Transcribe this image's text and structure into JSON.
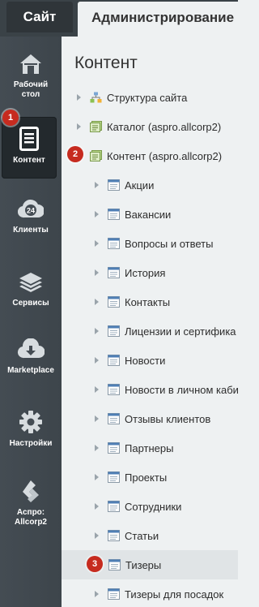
{
  "tabs": {
    "site": "Сайт",
    "admin": "Администрирование"
  },
  "sidebar": {
    "items": [
      {
        "label_lines": [
          "Рабочий",
          "стол"
        ],
        "icon": "home-icon"
      },
      {
        "label_lines": [
          "Контент"
        ],
        "icon": "document-icon"
      },
      {
        "label_lines": [
          "Клиенты"
        ],
        "icon": "clients-24-icon"
      },
      {
        "label_lines": [
          "Сервисы"
        ],
        "icon": "layers-icon"
      },
      {
        "label_lines": [
          "Marketplace"
        ],
        "icon": "cloud-download-icon"
      },
      {
        "label_lines": [
          "Настройки"
        ],
        "icon": "gear-icon"
      },
      {
        "label_lines": [
          "Аспро:",
          "Allcorp2"
        ],
        "icon": "aspro-logo-icon"
      }
    ]
  },
  "content": {
    "title": "Контент",
    "tree": [
      {
        "label": "Структура сайта",
        "icon": "site-structure-icon"
      },
      {
        "label": "Каталог (aspro.allcorp2)",
        "icon": "iblock-type-icon"
      },
      {
        "label": "Контент (aspro.allcorp2)",
        "icon": "iblock-type-icon"
      },
      {
        "label": "Акции",
        "icon": "list-icon"
      },
      {
        "label": "Вакансии",
        "icon": "list-icon"
      },
      {
        "label": "Вопросы и ответы",
        "icon": "list-icon"
      },
      {
        "label": "История",
        "icon": "list-icon"
      },
      {
        "label": "Контакты",
        "icon": "list-icon"
      },
      {
        "label": "Лицензии и сертифика",
        "icon": "list-icon"
      },
      {
        "label": "Новости",
        "icon": "list-icon"
      },
      {
        "label": "Новости в личном каби",
        "icon": "list-icon"
      },
      {
        "label": "Отзывы клиентов",
        "icon": "list-icon"
      },
      {
        "label": "Партнеры",
        "icon": "list-icon"
      },
      {
        "label": "Проекты",
        "icon": "list-icon"
      },
      {
        "label": "Сотрудники",
        "icon": "list-icon"
      },
      {
        "label": "Статьи",
        "icon": "list-icon"
      },
      {
        "label": "Тизеры",
        "icon": "list-icon"
      },
      {
        "label": "Тизеры для посадок",
        "icon": "list-icon"
      }
    ]
  },
  "badges": [
    "1",
    "2",
    "3"
  ],
  "colors": {
    "rail": "#40484e",
    "badge": "#c62b1f",
    "page": "#eef1f2"
  }
}
